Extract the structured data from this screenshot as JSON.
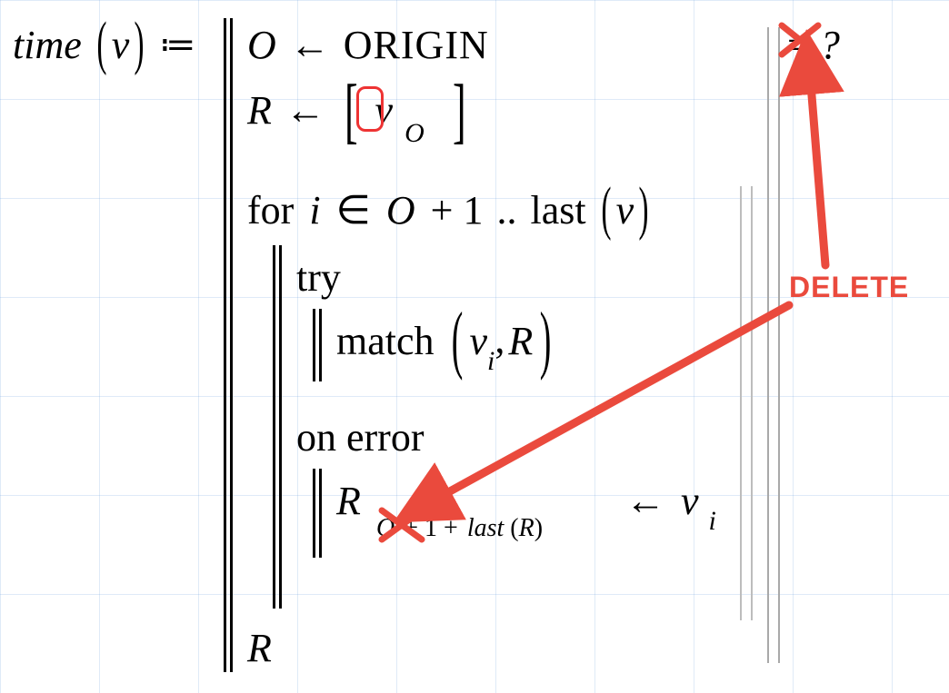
{
  "defn": {
    "lhs_func": "time",
    "lhs_arg": "v",
    "coloneq": "≔"
  },
  "body": {
    "line1": {
      "O": "O",
      "arrow": "←",
      "ORIGIN": "ORIGIN"
    },
    "line2": {
      "R": "R",
      "arrow": "←",
      "v": "v",
      "subO": "O"
    },
    "forline": {
      "for": "for",
      "i": "i",
      "in": "∈",
      "O": "O",
      "plus1": "+ 1",
      "dots": "..",
      "last": "last",
      "v": "v"
    },
    "tryline": {
      "try": "try"
    },
    "matchline": {
      "match": "match",
      "v": "v",
      "subi": "i",
      "comma": ",",
      "R": "R"
    },
    "onerror": {
      "on_error": "on error"
    },
    "assign": {
      "R": "R",
      "sub_O": "O",
      "sub_plus": "+ 1 +",
      "sub_last": "last",
      "sub_Rarg": "R",
      "arrow": "←",
      "v": "v",
      "subi": "i"
    },
    "returnR": "R"
  },
  "top_right": {
    "eq": "=",
    "q": " ?"
  },
  "annotation": {
    "delete": "DELETE"
  }
}
